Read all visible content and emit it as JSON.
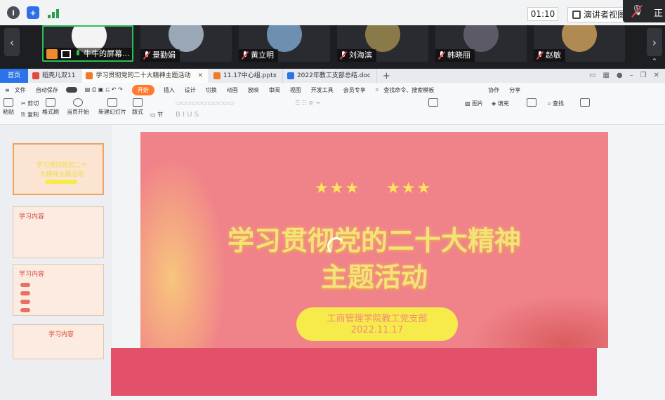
{
  "meeting": {
    "timer": "01:10",
    "presenter_view": "演讲者视图",
    "top_right_label": "正",
    "participants": [
      {
        "name": "牛牛的屏幕...",
        "active": true,
        "avatar_color": "#f4f4f4"
      },
      {
        "name": "景勤娟",
        "active": false,
        "avatar_color": "#9aa7b5"
      },
      {
        "name": "黄立明",
        "active": false,
        "avatar_color": "#6d8fb0"
      },
      {
        "name": "刘海滨",
        "active": false,
        "avatar_color": "#8a7a4a"
      },
      {
        "name": "韩晓丽",
        "active": false,
        "avatar_color": "#5b5a66"
      },
      {
        "name": "赵敏",
        "active": false,
        "avatar_color": "#b08a50"
      }
    ]
  },
  "wps": {
    "home_tab": "首页",
    "tabs": [
      {
        "label": "稻壳儿双11",
        "icon_color": "#e24a3b",
        "active": false,
        "closable": false
      },
      {
        "label": "学习贯彻党的二十大精神主题活动",
        "icon_color": "#f07a2a",
        "active": true,
        "closable": true
      },
      {
        "label": "11.17中心组.pptx",
        "icon_color": "#f07a2a",
        "active": false,
        "closable": false
      },
      {
        "label": "2022年教工支部总结.doc",
        "icon_color": "#2a73e8",
        "active": false,
        "closable": false
      }
    ],
    "menu": {
      "file": "文件",
      "autosave": "自动保存",
      "items": [
        "开始",
        "插入",
        "设计",
        "切换",
        "动画",
        "放映",
        "审阅",
        "视图",
        "开发工具",
        "会员专享"
      ],
      "search": "查找命令、搜索模板",
      "collab": "协作",
      "share": "分享"
    },
    "ribbon": {
      "paste": "粘贴",
      "cut": "剪切",
      "copy": "复制",
      "format_painter": "格式刷",
      "play_from_current": "当页开始",
      "new_slide": "新建幻灯片",
      "layout": "版式",
      "section": "节",
      "picture": "图片",
      "fill": "填充",
      "find": "查找"
    }
  },
  "thumbnails": [
    {
      "num": "1",
      "title": "学习贯彻党的二十大精神主题活动"
    },
    {
      "num": "2",
      "title": "学习内容"
    },
    {
      "num": "3",
      "title": "学习内容"
    },
    {
      "num": "4",
      "title": "学习内容"
    }
  ],
  "slide": {
    "stars_left": "★★★",
    "stars_right": "★★★",
    "title_line1": "学习贯彻党的二十大精神",
    "title_line2": "主题活动",
    "org": "工商管理学院教工党支部",
    "date": "2022.11.17"
  },
  "colors": {
    "active_tab_accent": "#ff7a2f",
    "slide_bg": "#f0838a",
    "title_color": "#f5e27a",
    "pill_color": "#f7ea4b"
  }
}
